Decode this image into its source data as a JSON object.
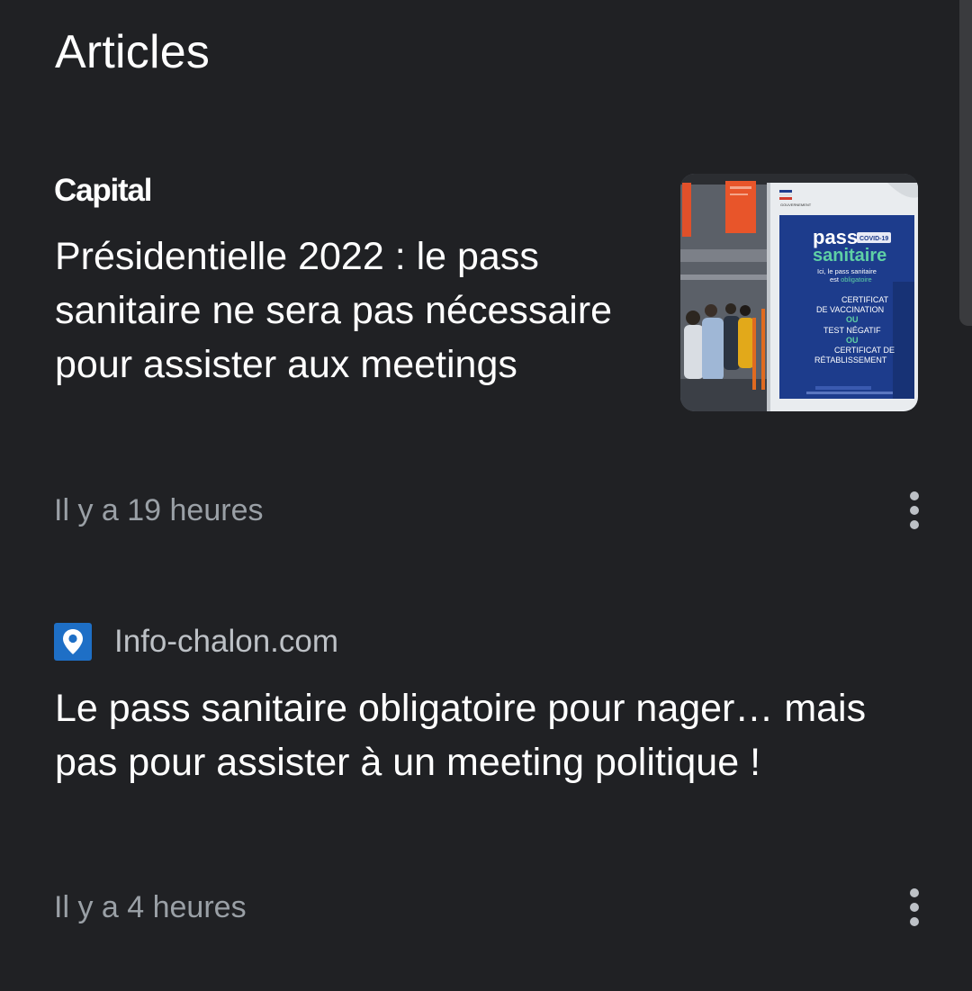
{
  "section": {
    "title": "Articles"
  },
  "articles": [
    {
      "source": "Capital",
      "headline": "Présidentielle 2022 : le pass sanitaire ne sera pas nécessaire pour assister aux meetings",
      "time": "Il y a 19 heures",
      "thumbnail": {
        "sign_title_1": "pass",
        "sign_badge": "COVID-19",
        "sign_title_2": "sanitaire",
        "sign_sub_1": "Ici, le pass sanitaire",
        "sign_sub_2a": "est ",
        "sign_sub_2b": "obligatoire",
        "sign_l1": "CERTIFICAT",
        "sign_l2": "DE VACCINATION",
        "sign_ou": "OU",
        "sign_l3": "TEST NÉGATIF",
        "sign_ou2": "OU",
        "sign_l4": "CERTIFICAT DE",
        "sign_l5": "RÉTABLISSEMENT",
        "header_text": "GOUVERNEMENT"
      }
    },
    {
      "source": "Info-chalon.com",
      "source_icon": "map-pin-icon",
      "headline": "Le pass sanitaire obligatoire pour nager… mais pas pour assister à un meeting politique !",
      "time": "Il y a 4 heures"
    }
  ],
  "colors": {
    "background": "#202124",
    "headline": "#ffffff",
    "meta": "#9aa0a6",
    "favicon_bg": "#1e6fc6"
  },
  "icons": {
    "more": "more-vert-icon"
  }
}
